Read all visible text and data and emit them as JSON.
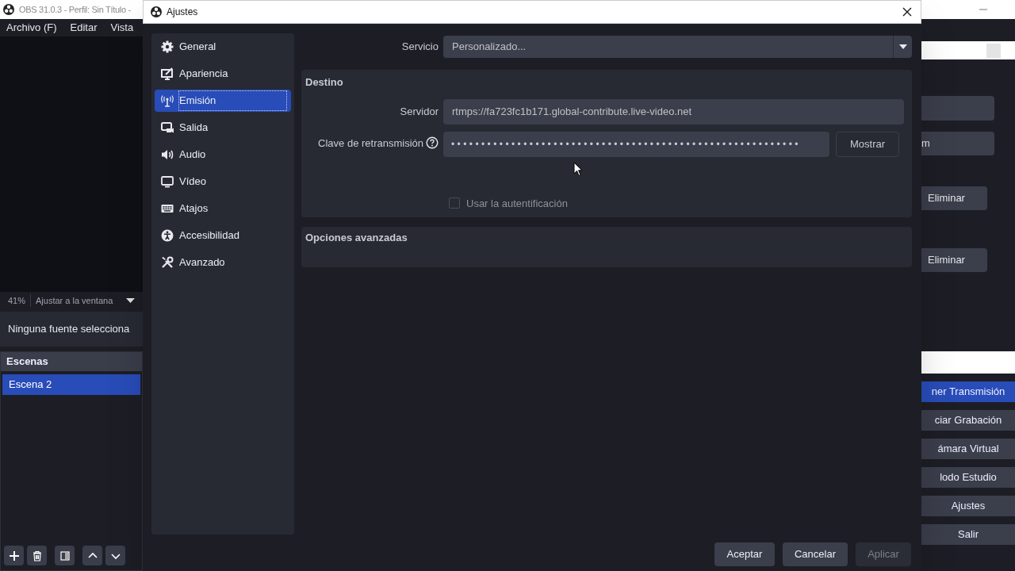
{
  "main_window": {
    "title": "OBS 31.0.3 - Perfil: Sin Título -",
    "menu": [
      "Archivo (F)",
      "Editar",
      "Vista"
    ],
    "zoom": {
      "percent": "41%",
      "mode": "Ajustar a la ventana"
    },
    "source_properties": "Ninguna fuente selecciona",
    "scenes": {
      "title": "Escenas",
      "items": [
        {
          "label": "Escena 2",
          "selected": true
        }
      ]
    },
    "right_fragments": {
      "field_text": "m",
      "buttons": [
        "Eliminar",
        "Eliminar"
      ]
    },
    "controls": [
      {
        "label": "ner Transmisión",
        "selected": true
      },
      {
        "label": "ciar Grabación",
        "selected": false
      },
      {
        "label": "ámara Virtual",
        "selected": false
      },
      {
        "label": "lodo Estudio",
        "selected": false
      },
      {
        "label": "Ajustes",
        "selected": false
      },
      {
        "label": "Salir",
        "selected": false
      }
    ]
  },
  "dialog": {
    "title": "Ajustes",
    "sidebar": [
      {
        "label": "General",
        "selected": false
      },
      {
        "label": "Apariencia",
        "selected": false
      },
      {
        "label": "Emisión",
        "selected": true
      },
      {
        "label": "Salida",
        "selected": false
      },
      {
        "label": "Audio",
        "selected": false
      },
      {
        "label": "Vídeo",
        "selected": false
      },
      {
        "label": "Atajos",
        "selected": false
      },
      {
        "label": "Accesibilidad",
        "selected": false
      },
      {
        "label": "Avanzado",
        "selected": false
      }
    ],
    "service": {
      "label": "Servicio",
      "value": "Personalizado..."
    },
    "destination": {
      "title": "Destino",
      "server": {
        "label": "Servidor",
        "value": "rtmps://fa723fc1b171.global-contribute.live-video.net"
      },
      "stream_key": {
        "label": "Clave de retransmisión",
        "value": "••••••••••••••••••••••••••••••••••••••••••••••••••••••••••",
        "button": "Mostrar"
      },
      "use_auth": {
        "label": "Usar la autentificación",
        "checked": false,
        "disabled": true
      }
    },
    "advanced": {
      "title": "Opciones avanzadas"
    },
    "buttons": [
      {
        "label": "Aceptar",
        "disabled": false
      },
      {
        "label": "Cancelar",
        "disabled": false
      },
      {
        "label": "Aplicar",
        "disabled": true
      }
    ]
  }
}
